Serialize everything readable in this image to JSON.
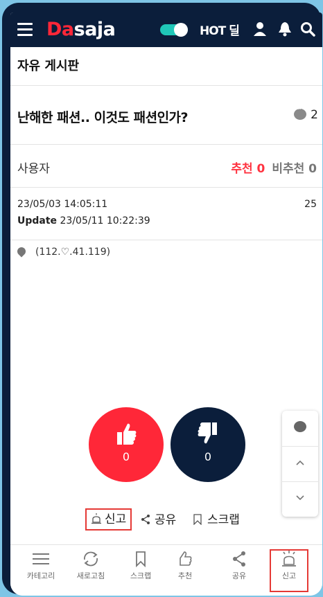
{
  "header": {
    "logo_prefix": "Da",
    "logo_suffix": "saja",
    "hot_label": "HOT 딜",
    "icons": [
      "menu-icon",
      "toggle-switch",
      "user-icon",
      "bell-icon",
      "search-icon"
    ]
  },
  "board": {
    "title": "자유 게시판"
  },
  "post": {
    "title": "난해한 패션.. 이것도 패션인가?",
    "comment_count": "2",
    "author": "사용자",
    "recommend_label": "추천",
    "recommend_count": "0",
    "not_recommend_label": "비추천",
    "not_recommend_count": "0",
    "created": "23/05/03 14:05:11",
    "update_label": "Update",
    "updated": "23/05/11 10:22:39",
    "views": "25",
    "ip": "(112.♡.41.119)"
  },
  "vote": {
    "up_count": "0",
    "down_count": "0"
  },
  "actions": {
    "report": "신고",
    "share": "공유",
    "scrap": "스크랩"
  },
  "bottom_nav": {
    "category": "카테고리",
    "refresh": "새로고침",
    "scrap": "스크랩",
    "recommend": "추천",
    "share": "공유",
    "report": "신고"
  },
  "colors": {
    "brand_red": "#ff2738",
    "navy": "#0b1e3b",
    "teal": "#20c7b8",
    "highlight": "#e53935"
  }
}
